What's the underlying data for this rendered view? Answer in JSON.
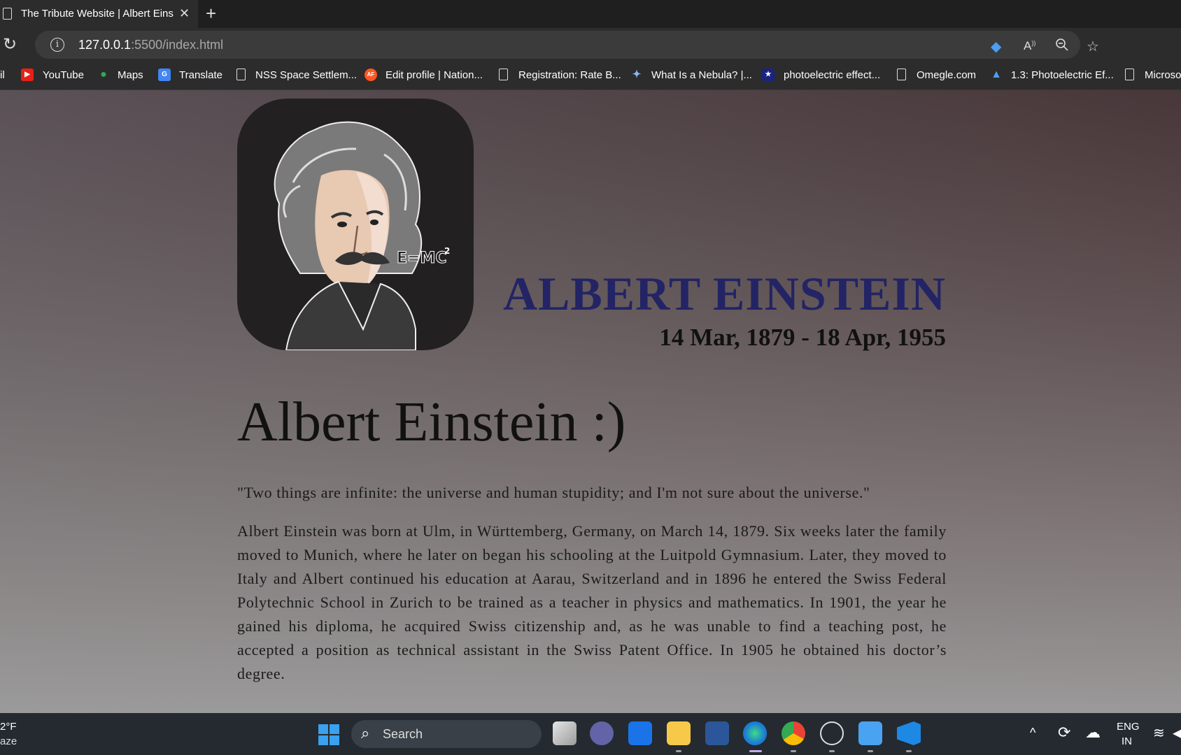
{
  "browser": {
    "tab_title": "The Tribute Website | Albert Einst",
    "url_host": "127.0.0.1",
    "url_rest": ":5500/index.html"
  },
  "bookmarks": [
    {
      "label": "il"
    },
    {
      "label": "YouTube"
    },
    {
      "label": "Maps"
    },
    {
      "label": "Translate"
    },
    {
      "label": "NSS Space Settlem..."
    },
    {
      "label": "Edit profile | Nation..."
    },
    {
      "label": "Registration: Rate B..."
    },
    {
      "label": "What Is a Nebula? |..."
    },
    {
      "label": "photoelectric effect..."
    },
    {
      "label": "Omegle.com"
    },
    {
      "label": "1.3: Photoelectric Ef..."
    },
    {
      "label": "Microso"
    }
  ],
  "page": {
    "name_heading": "ALBERT EINSTEIN",
    "dates": "14 Mar, 1879 - 18 Apr, 1955",
    "title": "Albert Einstein :)",
    "quote": "\"Two things are infinite: the universe and human stupidity; and I'm not sure about the universe.\"",
    "bio": "Albert Einstein was born at Ulm, in Württemberg, Germany, on March 14, 1879. Six weeks later the family moved to Munich, where he later on began his schooling at the Luitpold Gymnasium. Later, they moved to Italy and Albert continued his education at Aarau, Switzerland and in 1896 he entered the Swiss Federal Polytechnic School in Zurich to be trained as a teacher in physics and mathematics. In 1901, the year he gained his diploma, he acquired Swiss citizenship and, as he was unable to find a teaching post, he accepted a position as technical assistant in the Swiss Patent Office. In 1905 he obtained his doctor’s degree.",
    "portrait_formula": "E=MC",
    "portrait_exponent": "2"
  },
  "taskbar": {
    "weather_temp": "2°F",
    "weather_cond": "aze",
    "search_label": "Search",
    "lang_1": "ENG",
    "lang_2": "IN"
  },
  "colors": {
    "name_heading": "#232465",
    "portrait_bg": "#232022",
    "windows_blue": "#3aa0f0"
  }
}
